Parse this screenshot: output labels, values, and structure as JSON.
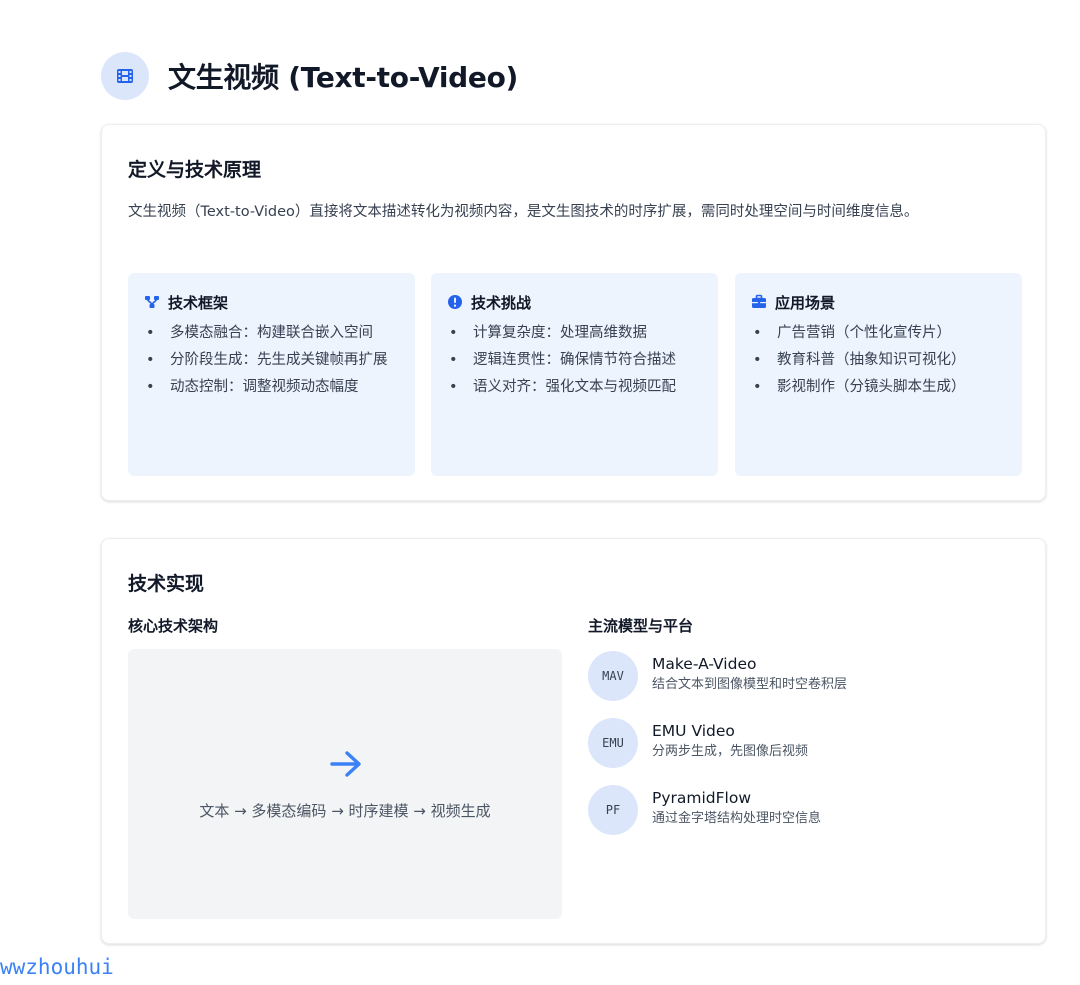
{
  "header": {
    "title": "文生视频 (Text-to-Video)",
    "icon": "film-icon"
  },
  "definition": {
    "title": "定义与技术原理",
    "intro": "文生视频（Text-to-Video）直接将文本描述转化为视频内容，是文生图技术的时序扩展，需同时处理空间与时间维度信息。",
    "boxes": [
      {
        "icon": "nodes-icon",
        "title": "技术框架",
        "items": [
          "多模态融合：构建联合嵌入空间",
          "分阶段生成：先生成关键帧再扩展",
          "动态控制：调整视频动态幅度"
        ]
      },
      {
        "icon": "alert-circle-icon",
        "title": "技术挑战",
        "items": [
          "计算复杂度：处理高维数据",
          "逻辑连贯性：确保情节符合描述",
          "语义对齐：强化文本与视频匹配"
        ]
      },
      {
        "icon": "briefcase-icon",
        "title": "应用场景",
        "items": [
          "广告营销（个性化宣传片）",
          "教育科普（抽象知识可视化）",
          "影视制作（分镜头脚本生成）"
        ]
      }
    ]
  },
  "implementation": {
    "title": "技术实现",
    "architecture": {
      "title": "核心技术架构",
      "icon": "arrow-right-icon",
      "flow": "文本 → 多模态编码 → 时序建模 → 视频生成"
    },
    "models": {
      "title": "主流模型与平台",
      "items": [
        {
          "abbr": "MAV",
          "name": "Make-A-Video",
          "desc": "结合文本到图像模型和时空卷积层"
        },
        {
          "abbr": "EMU",
          "name": "EMU Video",
          "desc": "分两步生成，先图像后视频"
        },
        {
          "abbr": "PF",
          "name": "PyramidFlow",
          "desc": "通过金字塔结构处理时空信息"
        }
      ]
    }
  },
  "watermark": "wwzhouhui",
  "colors": {
    "accent": "#3b82f6",
    "icon_bg": "#dbe6fb",
    "box_bg": "#eef4fe",
    "diagram_bg": "#f3f4f6"
  }
}
